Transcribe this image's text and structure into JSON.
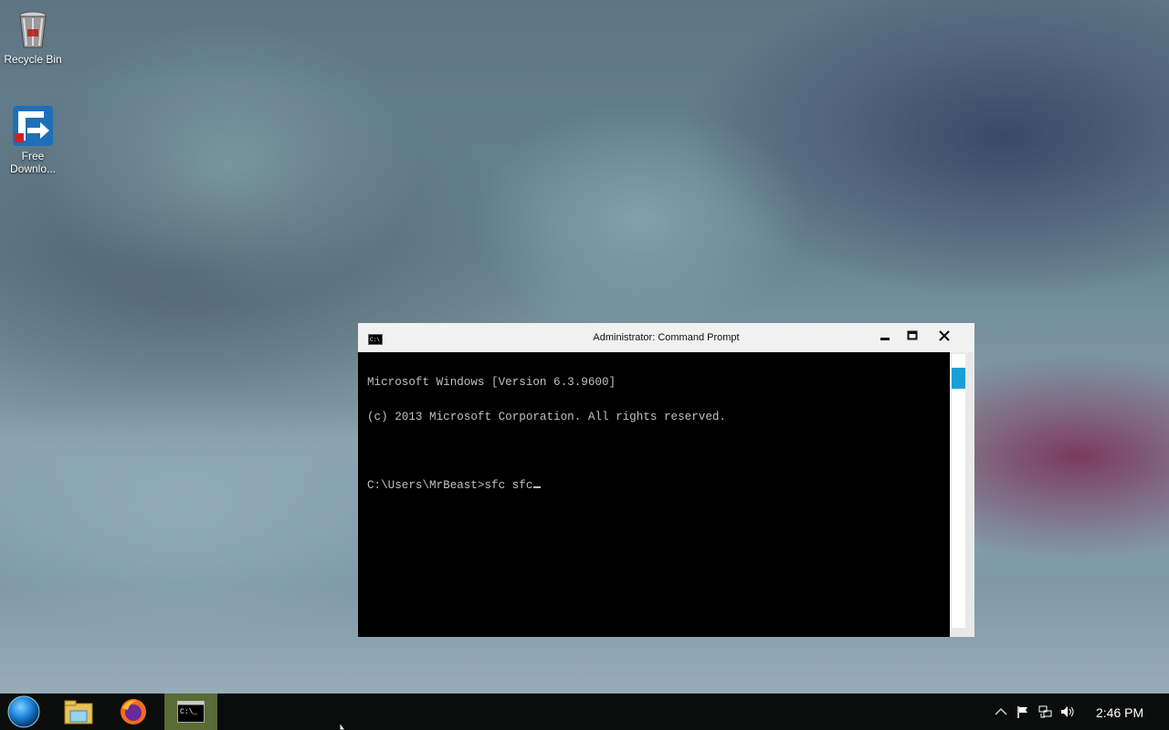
{
  "desktop": {
    "icons": [
      {
        "label": "Recycle Bin",
        "icon": "recycle-bin-icon"
      },
      {
        "label": "Free\nDownlo...",
        "icon": "free-download-manager-icon"
      }
    ]
  },
  "window": {
    "title": "Administrator: Command Prompt",
    "icon": "cmd-icon",
    "console_lines": [
      "Microsoft Windows [Version 6.3.9600]",
      "(c) 2013 Microsoft Corporation. All rights reserved.",
      "",
      "C:\\Users\\MrBeast>sfc sfc"
    ]
  },
  "taskbar": {
    "items": [
      "start-orb-icon",
      "file-explorer-icon",
      "firefox-icon",
      "command-prompt-icon"
    ],
    "active_item": "command-prompt-icon",
    "tray_icons": [
      "chevron-up-icon",
      "flag-icon",
      "network-icon",
      "speaker-icon"
    ],
    "clock": "2:46 PM"
  },
  "colors": {
    "taskbar_bg": "#0b0d0c",
    "active_task_bg": "#5a6b35",
    "console_bg": "#000000",
    "console_text": "#c0c0c0",
    "scroll_thumb": "#1aa0d8"
  }
}
